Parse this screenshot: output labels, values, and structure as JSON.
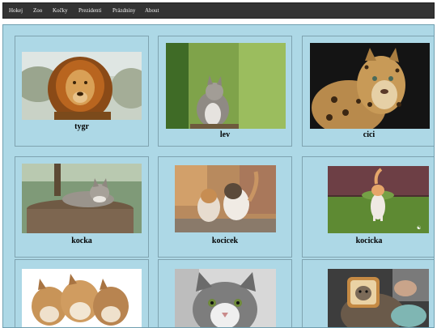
{
  "nav": {
    "items": [
      {
        "label": "Hokej"
      },
      {
        "label": "Zoo"
      },
      {
        "label": "Kočky"
      },
      {
        "label": "Prezidenti"
      },
      {
        "label": "Prázdniny"
      },
      {
        "label": "About"
      }
    ]
  },
  "gallery": {
    "cards": [
      {
        "caption": "tygr",
        "image": "lion-photo"
      },
      {
        "caption": "lev",
        "image": "kitten-in-grass-photo"
      },
      {
        "caption": "cici",
        "image": "leopard-photo"
      },
      {
        "caption": "kocka",
        "image": "cat-on-stump-photo"
      },
      {
        "caption": "kocicek",
        "image": "two-kittens-photo"
      },
      {
        "caption": "kocicka",
        "image": "kitten-walking-photo"
      },
      {
        "caption": "",
        "image": "three-kittens-photo"
      },
      {
        "caption": "",
        "image": "grey-cat-photo"
      },
      {
        "caption": "",
        "image": "cat-with-bread-photo"
      }
    ]
  },
  "colors": {
    "nav_background": "#333333",
    "nav_text": "#f2f2f2",
    "content_background": "#ADD8E6"
  }
}
